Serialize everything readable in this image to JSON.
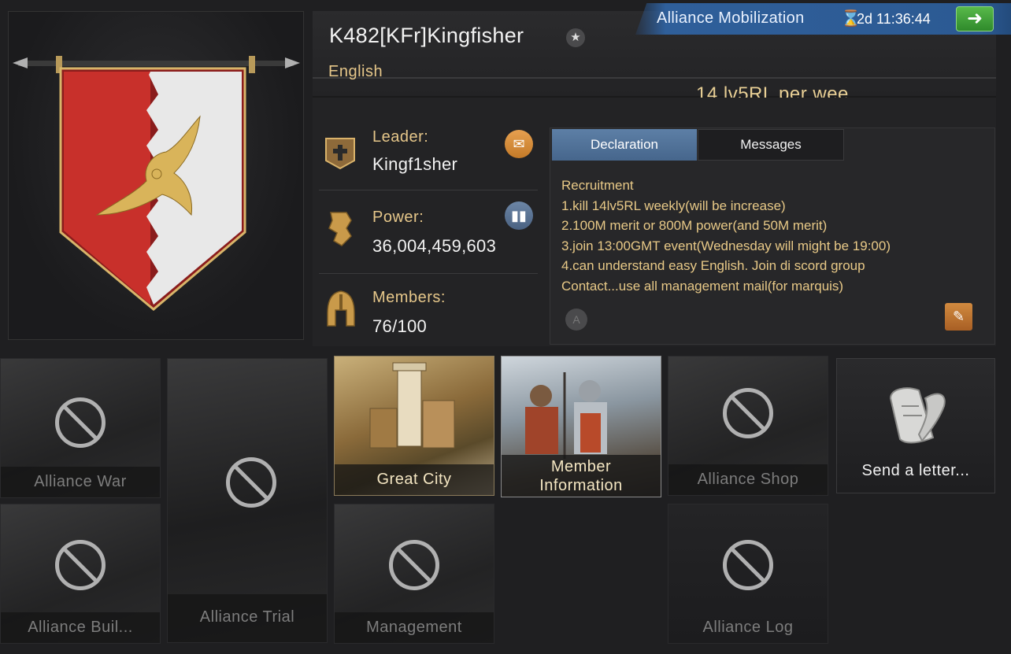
{
  "alliance": {
    "name": "K482[KFr]Kingfisher",
    "language": "English",
    "motto": "14 lv5RL per wee"
  },
  "event": {
    "label": "Alliance Mobilization",
    "timer": "2d 11:36:44",
    "icon": "hourglass-icon",
    "go_icon": "arrow-right-icon"
  },
  "stats": {
    "leader_label": "Leader:",
    "leader_value": "Kingf1sher",
    "power_label": "Power:",
    "power_value": "36,004,459,603",
    "members_label": "Members:",
    "members_value": "76/100"
  },
  "tabs": {
    "declaration": "Declaration",
    "messages": "Messages"
  },
  "declaration_lines": [
    "Recruitment",
    "1.kill 14lv5RL weekly(will be increase)",
    "2.100M merit or 800M power(and 50M merit)",
    "3.join 13:00GMT event(Wednesday will might be 19:00)",
    "4.can understand easy English. Join di scord group",
    "Contact...use all management mail(for marquis)"
  ],
  "tiles": {
    "alliance_war": "Alliance War",
    "alliance_trial": "Alliance Trial",
    "great_city": "Great City",
    "member_information": "Member\nInformation",
    "alliance_shop": "Alliance Shop",
    "send_letter": "Send a letter...",
    "alliance_buildings": "Alliance Buil...",
    "management": "Management",
    "alliance_log": "Alliance Log"
  },
  "colors": {
    "accent_gold": "#e6c78a",
    "tab_active": "#5d7fa6",
    "event_blue": "#2f5f9a",
    "go_green": "#3a9a34",
    "banner_red": "#c8302b"
  }
}
